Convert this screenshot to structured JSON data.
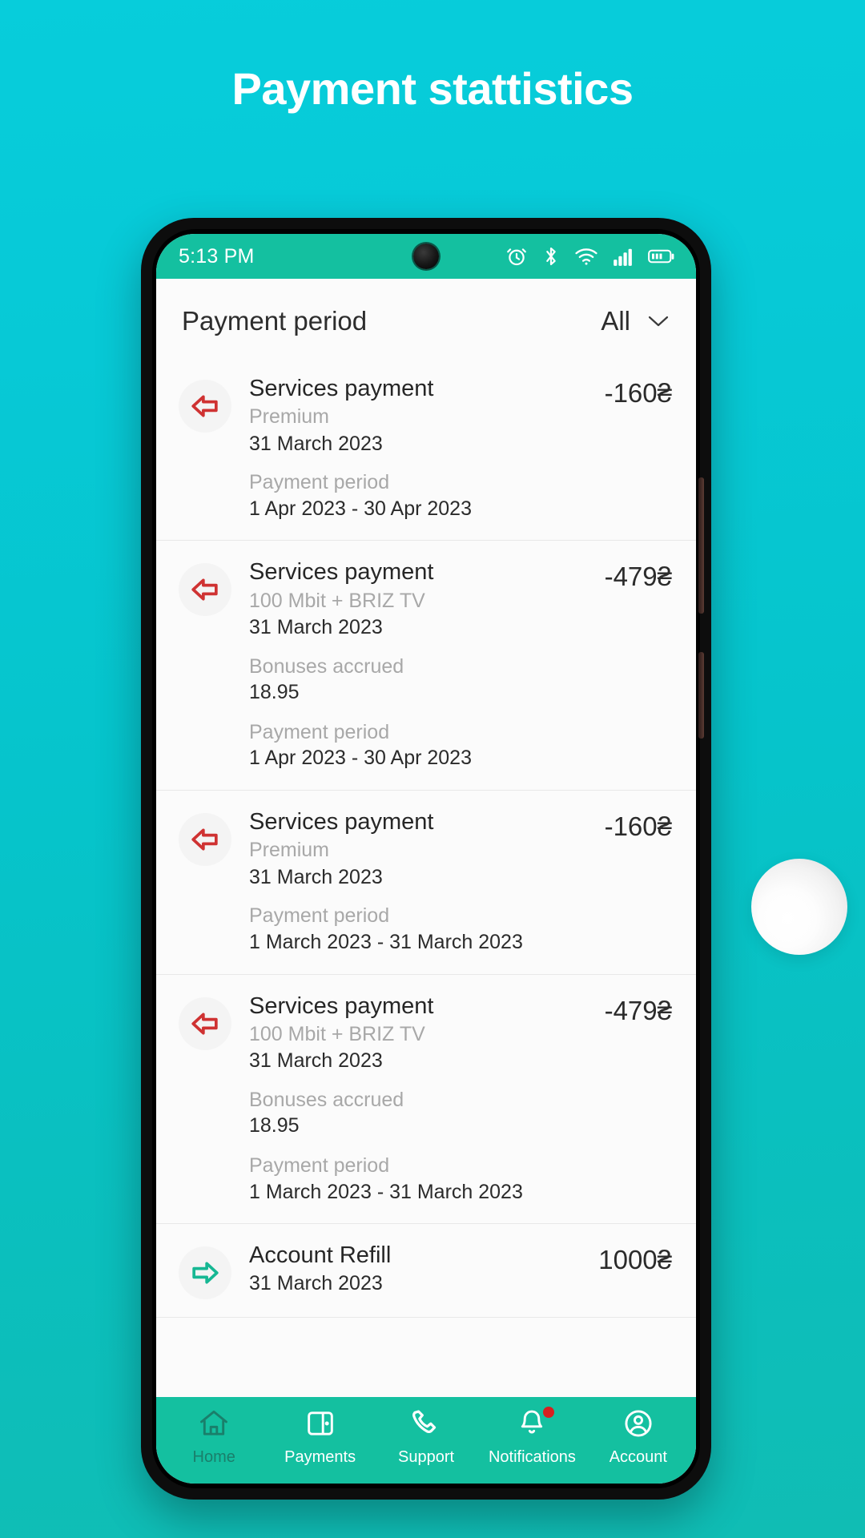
{
  "poster": {
    "title": "Payment stattistics"
  },
  "theme": {
    "background_start": "#07cddb",
    "background_end": "#10bdb4",
    "accent_green": "#14c0a0",
    "debit_red": "#cf3232",
    "credit_green": "#16b793",
    "badge_red": "#d62020"
  },
  "status_bar": {
    "time": "5:13 PM",
    "icons": [
      "alarm-icon",
      "bluetooth-icon",
      "wifi-icon",
      "signal-icon",
      "battery-icon"
    ]
  },
  "app_header": {
    "title": "Payment period",
    "filter_value": "All",
    "filter_icon": "chevron-down-icon"
  },
  "transactions": [
    {
      "icon": "arrow-left-icon",
      "direction": "debit",
      "title": "Services payment",
      "subtitle": "Premium",
      "date": "31 March 2023",
      "amount": "-160₴",
      "details": [
        {
          "label": "Payment period",
          "value": "1 Apr 2023 - 30 Apr 2023"
        }
      ]
    },
    {
      "icon": "arrow-left-icon",
      "direction": "debit",
      "title": "Services payment",
      "subtitle": "100 Mbit + BRIZ TV",
      "date": "31 March 2023",
      "amount": "-479₴",
      "details": [
        {
          "label": "Bonuses accrued",
          "value": "18.95"
        },
        {
          "label": "Payment period",
          "value": "1 Apr 2023 - 30 Apr 2023"
        }
      ]
    },
    {
      "icon": "arrow-left-icon",
      "direction": "debit",
      "title": "Services payment",
      "subtitle": "Premium",
      "date": "31 March 2023",
      "amount": "-160₴",
      "details": [
        {
          "label": "Payment period",
          "value": "1 March 2023 - 31 March 2023"
        }
      ]
    },
    {
      "icon": "arrow-left-icon",
      "direction": "debit",
      "title": "Services payment",
      "subtitle": "100 Mbit + BRIZ TV",
      "date": "31 March 2023",
      "amount": "-479₴",
      "details": [
        {
          "label": "Bonuses accrued",
          "value": "18.95"
        },
        {
          "label": "Payment period",
          "value": "1 March 2023 - 31 March 2023"
        }
      ]
    },
    {
      "icon": "arrow-right-icon",
      "direction": "credit",
      "title": "Account Refill",
      "subtitle": "",
      "date": "31 March 2023",
      "amount": "1000₴",
      "details": []
    }
  ],
  "bottom_nav": [
    {
      "label": "Home",
      "icon": "home-icon",
      "active": true,
      "badge": false
    },
    {
      "label": "Payments",
      "icon": "wallet-icon",
      "active": false,
      "badge": false
    },
    {
      "label": "Support",
      "icon": "phone-icon",
      "active": false,
      "badge": false
    },
    {
      "label": "Notifications",
      "icon": "bell-icon",
      "active": false,
      "badge": true
    },
    {
      "label": "Account",
      "icon": "user-circle-icon",
      "active": false,
      "badge": false
    }
  ]
}
